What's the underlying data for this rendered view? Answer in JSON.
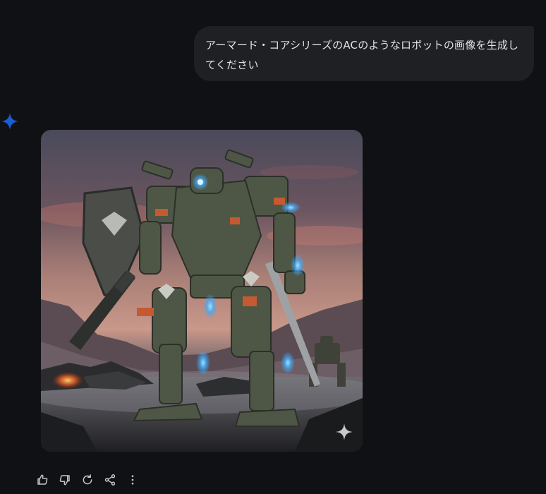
{
  "user_message": {
    "text": "アーマード・コアシリーズのACのようなロボットの画像を生成してください"
  },
  "assistant": {
    "avatar_icon": "gemini-sparkle-icon",
    "image_icon": "sparkle-watermark-icon"
  },
  "actions": [
    {
      "name": "thumbs-up-icon"
    },
    {
      "name": "thumbs-down-icon"
    },
    {
      "name": "regenerate-icon"
    },
    {
      "name": "share-icon"
    },
    {
      "name": "more-options-icon"
    }
  ],
  "colors": {
    "background": "#0f1114",
    "bubble": "#1f2023",
    "text": "#e3e3e3",
    "accent": "#1a5bd6",
    "icon": "#c4c7c5"
  }
}
